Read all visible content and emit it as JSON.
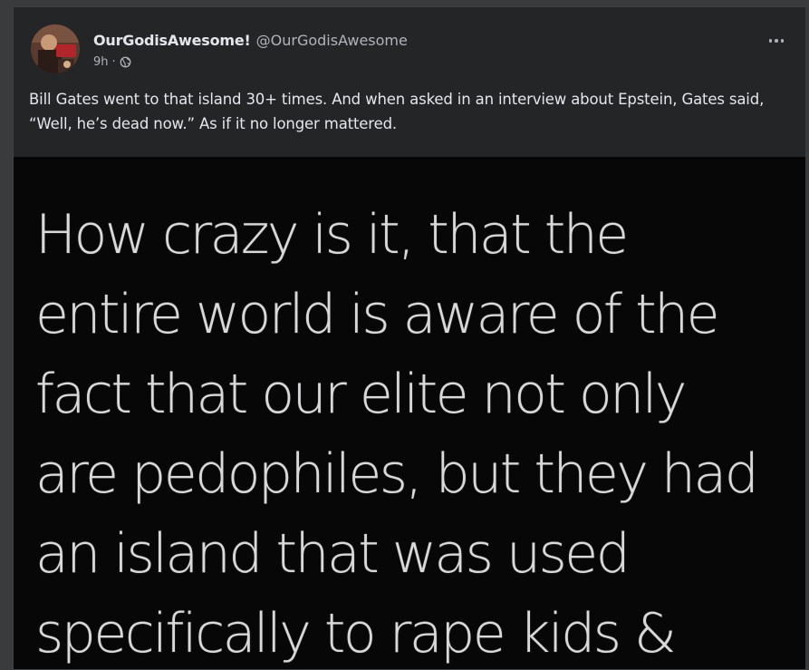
{
  "post": {
    "author": {
      "display_name": "OurGodisAwesome!",
      "handle": "@OurGodisAwesome",
      "avatar_icon": "avatar-photo"
    },
    "time": "9h",
    "separator": "·",
    "audience_icon": "globe-icon",
    "more_icon": "more-options-icon",
    "text": "Bill Gates went to that island 30+ times. And when asked in an interview about Epstein, Gates said, “Well, he’s dead now.” As if it no longer mattered.",
    "image": {
      "lines": [
        "How crazy is it, that the",
        "entire world is aware of the",
        "fact that our elite not only",
        "are pedophiles, but they had",
        "an island that was used",
        "specifically to rape kids &"
      ]
    }
  },
  "colors": {
    "page_background": "#3a3b3c",
    "card_background": "#242526",
    "primary_text": "#e4e6eb",
    "secondary_text": "#b0b3b8",
    "image_background": "#070708",
    "image_text": "#d9d9d9"
  }
}
